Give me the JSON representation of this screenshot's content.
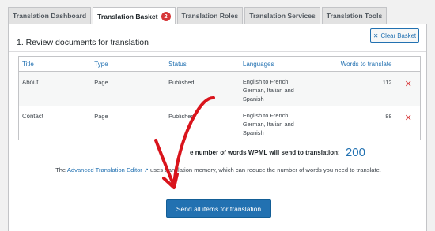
{
  "tabs": [
    {
      "label": "Translation Dashboard"
    },
    {
      "label": "Translation Basket",
      "badge": "2"
    },
    {
      "label": "Translation Roles"
    },
    {
      "label": "Translation Services"
    },
    {
      "label": "Translation Tools"
    }
  ],
  "section_title": "1. Review documents for translation",
  "clear_button": {
    "icon": "close-icon",
    "label": "Clear Basket"
  },
  "table": {
    "headers": {
      "title": "Title",
      "type": "Type",
      "status": "Status",
      "languages": "Languages",
      "words": "Words to translate"
    },
    "rows": [
      {
        "title": "About",
        "type": "Page",
        "status": "Published",
        "lang1": "English to French,",
        "lang2": "German, Italian and",
        "lang3": "Spanish",
        "words": "112"
      },
      {
        "title": "Contact",
        "type": "Page",
        "status": "Published",
        "lang1": "English to French,",
        "lang2": "German, Italian and",
        "lang3": "Spanish",
        "words": "88"
      }
    ]
  },
  "total": {
    "label": "e number of words WPML will send to translation:",
    "value": "200"
  },
  "note": {
    "prefix": "The",
    "link": "Advanced Translation Editor",
    "suffix": "uses translation memory, which can reduce the number of words you need to translate."
  },
  "send_button": {
    "label": "Send all items for translation"
  },
  "colors": {
    "accent": "#2271b1",
    "danger": "#d63638",
    "annotation": "#d9141c"
  }
}
